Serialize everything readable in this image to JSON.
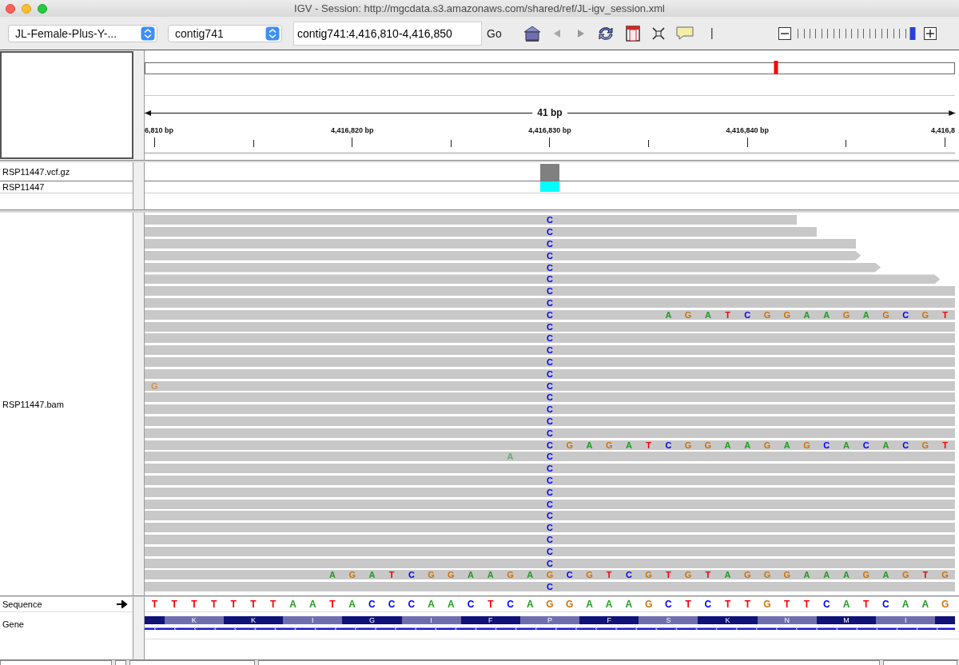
{
  "window": {
    "title": "IGV - Session: http://mgcdata.s3.amazonaws.com/shared/ref/JL-igv_session.xml"
  },
  "toolbar": {
    "genome": "JL-Female-Plus-Y-...",
    "chromosome": "contig741",
    "locus": "contig741:4,416,810-4,416,850",
    "go": "Go",
    "back_disabled": true,
    "zoom": {
      "level": 0.96
    }
  },
  "ruler": {
    "overview": {
      "level": 0.78
    },
    "span": "41 bp",
    "ticks": [
      {
        "major": true,
        "label": "6,810 bp"
      },
      {
        "major": false
      },
      {
        "major": true,
        "label": "4,416,820 bp"
      },
      {
        "major": false
      },
      {
        "major": true,
        "label": "4,416,830 bp"
      },
      {
        "major": false
      },
      {
        "major": true,
        "label": "4,416,840 bp"
      },
      {
        "major": false
      },
      {
        "major": true,
        "label": "4,416,8"
      }
    ]
  },
  "variant_track": {
    "name": "RSP11447.vcf.gz",
    "sites": [
      {
        "color": "#808080"
      }
    ]
  },
  "sample_track": {
    "name": "RSP11447",
    "genotypes": [
      {
        "color": "#00ffff"
      }
    ]
  },
  "alignment_track": {
    "name": "RSP11447.bam",
    "reads": [
      {
        "segments": [
          {
            "bases": [
              "C"
            ]
          }
        ]
      },
      {
        "segments": [
          {
            "bases": [
              "C"
            ]
          }
        ]
      },
      {
        "segments": [
          {
            "bases": [
              "C"
            ]
          }
        ]
      },
      {
        "strand_arrow": true,
        "segments": [
          {
            "bases": [
              "C"
            ]
          }
        ]
      },
      {
        "strand_arrow": true,
        "segments": [
          {
            "bases": [
              "C"
            ]
          }
        ]
      },
      {
        "strand_arrow": true,
        "segments": [
          {
            "bases": [
              "C"
            ]
          }
        ]
      },
      {
        "segments": [
          {
            "bases": [
              "C"
            ]
          }
        ]
      },
      {
        "segments": [
          {
            "bases": [
              "C"
            ]
          }
        ]
      },
      {
        "segments": [
          {
            "bases": [
              "C"
            ]
          },
          {
            "bases": [
              "A",
              "G",
              "A",
              "T",
              "C",
              "G",
              "G",
              "A",
              "A",
              "G",
              "A",
              "G",
              "C",
              "G",
              "T"
            ]
          }
        ]
      },
      {
        "segments": [
          {
            "bases": [
              "C"
            ]
          }
        ]
      },
      {
        "segments": [
          {
            "bases": [
              "C"
            ]
          }
        ]
      },
      {
        "segments": [
          {
            "bases": [
              "C"
            ]
          }
        ]
      },
      {
        "segments": [
          {
            "bases": [
              "C"
            ]
          }
        ]
      },
      {
        "segments": [
          {
            "bases": [
              "C"
            ]
          }
        ]
      },
      {
        "segments": [
          {
            "bases": [
              "G"
            ],
            "low_quality": true
          },
          {
            "bases": [
              "C"
            ]
          }
        ]
      },
      {
        "segments": [
          {
            "bases": [
              "C"
            ]
          }
        ]
      },
      {
        "segments": [
          {
            "bases": [
              "C"
            ]
          }
        ]
      },
      {
        "segments": [
          {
            "bases": [
              "C"
            ]
          }
        ]
      },
      {
        "segments": [
          {
            "bases": [
              "C"
            ]
          }
        ]
      },
      {
        "segments": [
          {
            "bases": [
              "C",
              "G",
              "A",
              "G",
              "A",
              "T",
              "C",
              "G",
              "G",
              "A",
              "A",
              "G",
              "A",
              "G",
              "C",
              "A",
              "C",
              "A",
              "C",
              "G",
              "T"
            ]
          }
        ]
      },
      {
        "segments": [
          {
            "bases": [
              "A"
            ],
            "low_quality": true
          },
          {
            "bases": [
              "C"
            ]
          }
        ]
      },
      {
        "segments": [
          {
            "bases": [
              "C"
            ]
          }
        ]
      },
      {
        "segments": [
          {
            "bases": [
              "C"
            ]
          }
        ]
      },
      {
        "segments": [
          {
            "bases": [
              "C"
            ]
          }
        ]
      },
      {
        "segments": [
          {
            "bases": [
              "C"
            ]
          }
        ]
      },
      {
        "segments": [
          {
            "bases": [
              "C"
            ]
          }
        ]
      },
      {
        "segments": [
          {
            "bases": [
              "C"
            ]
          }
        ]
      },
      {
        "segments": [
          {
            "bases": [
              "C"
            ]
          }
        ]
      },
      {
        "segments": [
          {
            "bases": [
              "C"
            ]
          }
        ]
      },
      {
        "segments": [
          {
            "bases": [
              "C"
            ]
          }
        ]
      },
      {
        "segments": [
          {
            "bases": [
              "A",
              "G",
              "A",
              "T",
              "C",
              "G",
              "G",
              "A",
              "A",
              "G",
              "A",
              "G",
              "C",
              "G",
              "T",
              "C",
              "G",
              "T",
              "G",
              "T",
              "A",
              "G",
              "G",
              "G",
              "A",
              "A",
              "A",
              "G",
              "A",
              "G",
              "T",
              "G"
            ]
          }
        ]
      },
      {
        "segments": [
          {
            "bases": [
              "C"
            ]
          }
        ]
      }
    ]
  },
  "sequence_track": {
    "name": "Sequence",
    "bases": [
      "T",
      "T",
      "T",
      "T",
      "T",
      "T",
      "T",
      "A",
      "A",
      "T",
      "A",
      "C",
      "C",
      "C",
      "A",
      "A",
      "C",
      "T",
      "C",
      "A",
      "G",
      "G",
      "A",
      "A",
      "A",
      "G",
      "C",
      "T",
      "C",
      "T",
      "T",
      "G",
      "T",
      "T",
      "C",
      "A",
      "T",
      "C",
      "A",
      "A",
      "G"
    ]
  },
  "gene_track": {
    "name": "Gene",
    "codons": [
      "K",
      "K",
      "I",
      "G",
      "I",
      "F",
      "P",
      "F",
      "S",
      "K",
      "N",
      "M",
      "I"
    ]
  }
}
